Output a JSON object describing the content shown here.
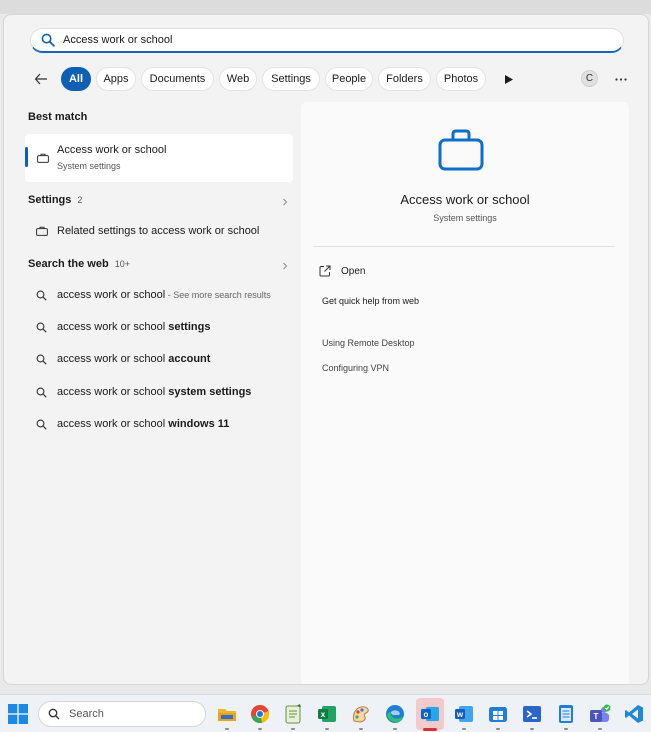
{
  "search": {
    "query": "Access work or school"
  },
  "filters": {
    "items": [
      "All",
      "Apps",
      "Documents",
      "Web",
      "Settings",
      "People",
      "Folders",
      "Photos"
    ],
    "active": "All",
    "avatar_initial": "C"
  },
  "best_match": {
    "header": "Best match",
    "title": "Access work or school",
    "subtitle": "System settings"
  },
  "settings_section": {
    "header": "Settings",
    "count": "2",
    "item": "Related settings to access work or school"
  },
  "web_section": {
    "header": "Search the web",
    "count": "10+",
    "first": {
      "text": "access work or school",
      "note": " - See more search results"
    },
    "suggestions": [
      {
        "base": "access work or school ",
        "bold": "settings"
      },
      {
        "base": "access work or school ",
        "bold": "account"
      },
      {
        "base": "access work or school ",
        "bold": "system settings"
      },
      {
        "base": "access work or school ",
        "bold": "windows 11"
      }
    ]
  },
  "preview": {
    "title": "Access work or school",
    "subtitle": "System settings",
    "open_label": "Open",
    "help_header": "Get quick help from web",
    "links": [
      "Using Remote Desktop",
      "Configuring VPN"
    ]
  },
  "taskbar": {
    "search_label": "Search",
    "apps": [
      "file-explorer",
      "chrome",
      "notepad",
      "excel",
      "paint",
      "edge",
      "outlook",
      "word",
      "store",
      "terminal",
      "notepad-doc",
      "teams",
      "vscode"
    ],
    "colors": {
      "accent": "#0f5fb5",
      "outlook_active": "#d13438"
    }
  }
}
